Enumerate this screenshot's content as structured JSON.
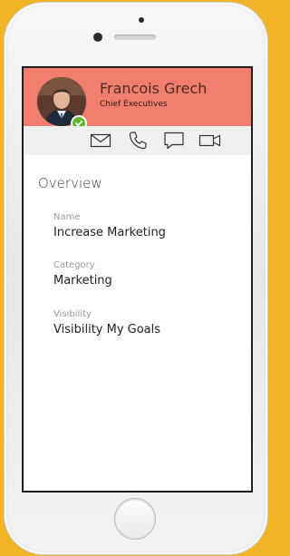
{
  "profile": {
    "name": "Francois Grech",
    "title": "Chief Executives",
    "status": "available"
  },
  "actions": [
    {
      "icon": "mail-icon"
    },
    {
      "icon": "phone-icon"
    },
    {
      "icon": "chat-icon"
    },
    {
      "icon": "video-icon"
    }
  ],
  "overview": {
    "heading": "Overview",
    "fields": [
      {
        "label": "Name",
        "value": "Increase Marketing"
      },
      {
        "label": "Category",
        "value": "Marketing"
      },
      {
        "label": "Visibility",
        "value": "Visibility My Goals"
      }
    ]
  },
  "colors": {
    "header_bg": "#f27f6d",
    "status_green": "#62b52d",
    "background": "#f0b426"
  }
}
